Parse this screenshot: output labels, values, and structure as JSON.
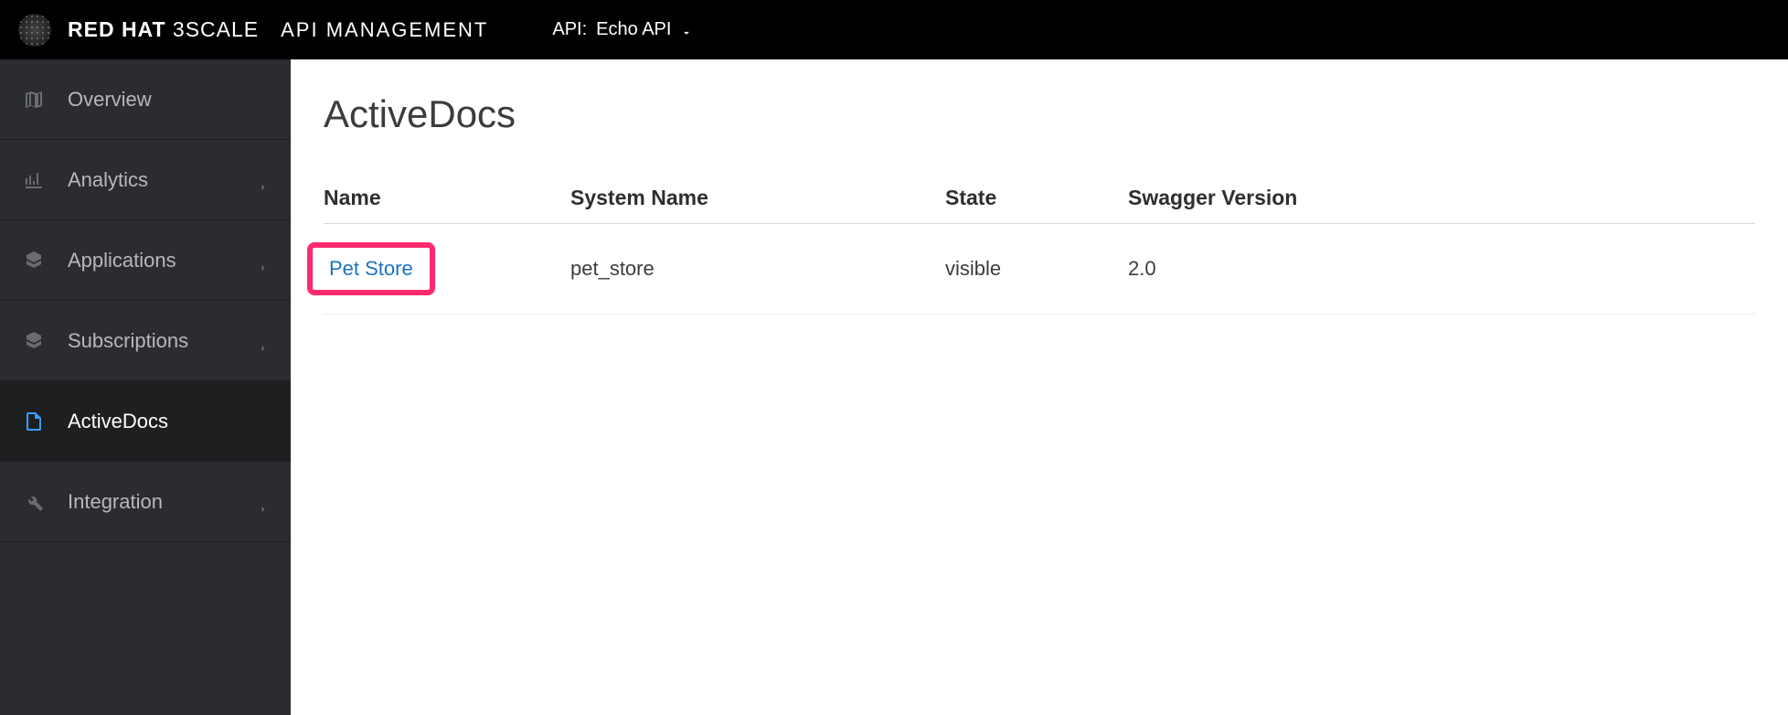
{
  "header": {
    "brand_strong": "RED HAT",
    "brand_light": "3SCALE",
    "product": "API MANAGEMENT",
    "api_selector_prefix": "API:",
    "api_selector_value": "Echo API"
  },
  "sidebar": {
    "items": [
      {
        "label": "Overview",
        "icon": "map-icon",
        "has_children": false
      },
      {
        "label": "Analytics",
        "icon": "chart-icon",
        "has_children": true
      },
      {
        "label": "Applications",
        "icon": "cubes-icon",
        "has_children": true
      },
      {
        "label": "Subscriptions",
        "icon": "cubes-icon",
        "has_children": true
      },
      {
        "label": "ActiveDocs",
        "icon": "document-icon",
        "has_children": false
      },
      {
        "label": "Integration",
        "icon": "wrench-icon",
        "has_children": true
      }
    ],
    "active_index": 4
  },
  "main": {
    "title": "ActiveDocs",
    "table": {
      "columns": [
        "Name",
        "System Name",
        "State",
        "Swagger Version"
      ],
      "rows": [
        {
          "name": "Pet Store",
          "system_name": "pet_store",
          "state": "visible",
          "swagger_version": "2.0",
          "highlighted": true
        }
      ]
    }
  }
}
